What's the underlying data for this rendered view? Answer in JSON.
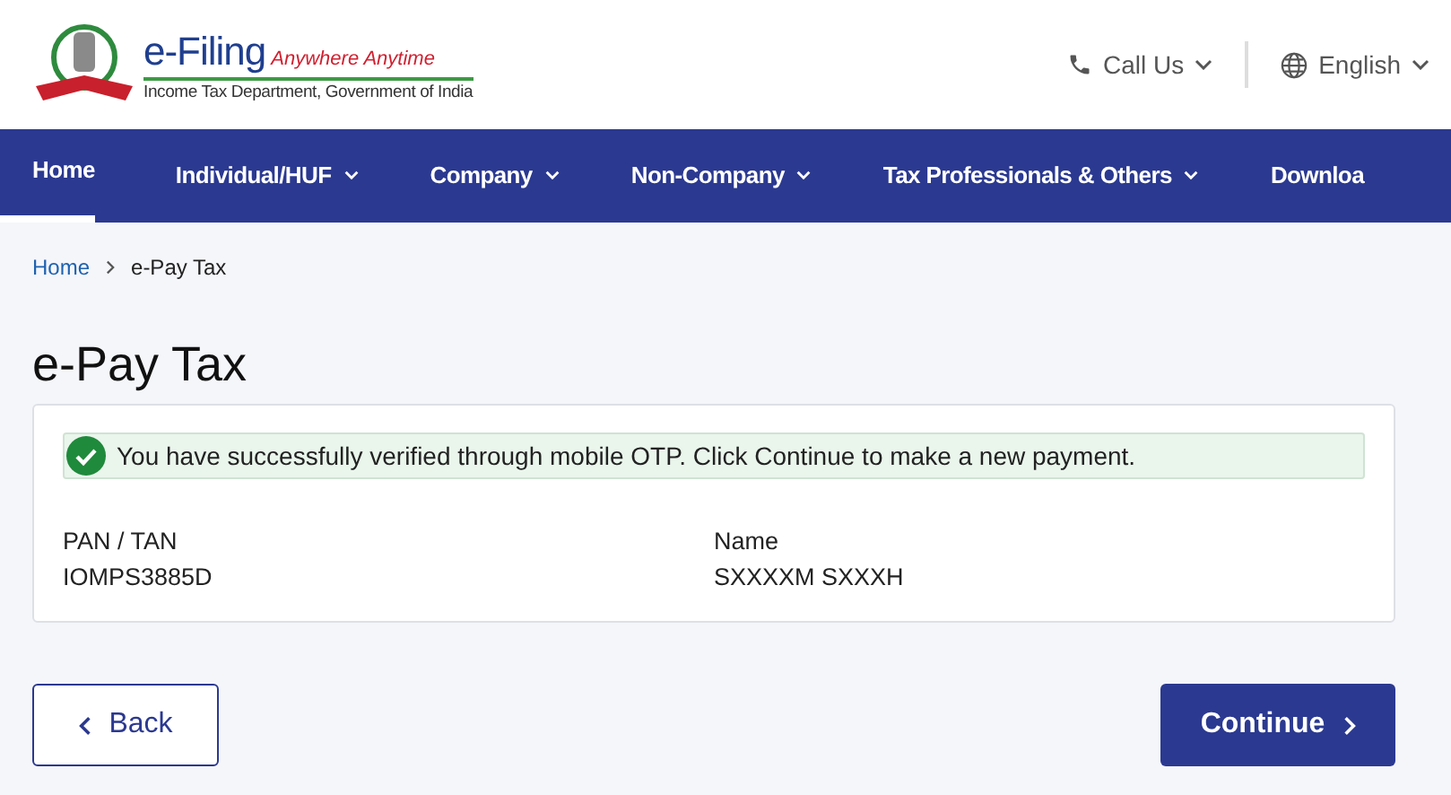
{
  "header": {
    "brand": "e-Filing",
    "tagline": "Anywhere Anytime",
    "subtitle": "Income Tax Department, Government of India",
    "call_us": "Call Us",
    "language": "English"
  },
  "nav": [
    {
      "label": "Home",
      "selected": true,
      "dropdown": false
    },
    {
      "label": "Individual/HUF",
      "selected": false,
      "dropdown": true
    },
    {
      "label": "Company",
      "selected": false,
      "dropdown": true
    },
    {
      "label": "Non-Company",
      "selected": false,
      "dropdown": true
    },
    {
      "label": "Tax Professionals & Others",
      "selected": false,
      "dropdown": true
    },
    {
      "label": "Downloa",
      "selected": false,
      "dropdown": false
    }
  ],
  "breadcrumb": [
    "Home",
    "e-Pay Tax"
  ],
  "page_title": "e-Pay Tax",
  "alert": "You have successfully verified through mobile OTP. Click Continue to make a new payment.",
  "fields": [
    {
      "label": "PAN / TAN",
      "value": "IOMPS3885D"
    },
    {
      "label": "Name",
      "value": "SXXXXM SXXXH"
    }
  ],
  "buttons": {
    "back": "Back",
    "continue": "Continue"
  }
}
